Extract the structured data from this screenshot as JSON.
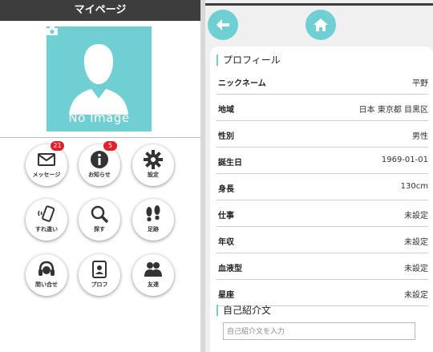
{
  "left": {
    "title": "マイページ",
    "avatar_text": "No Image",
    "menu": [
      {
        "label": "メッセージ",
        "icon": "mail-icon",
        "badge": "21"
      },
      {
        "label": "お知らせ",
        "icon": "info-icon",
        "badge": "5"
      },
      {
        "label": "設定",
        "icon": "gear-icon",
        "badge": ""
      },
      {
        "label": "すれ違い",
        "icon": "phone-vibrate-icon",
        "badge": ""
      },
      {
        "label": "探す",
        "icon": "search-icon",
        "badge": ""
      },
      {
        "label": "足跡",
        "icon": "footprints-icon",
        "badge": ""
      },
      {
        "label": "問い合せ",
        "icon": "headset-icon",
        "badge": ""
      },
      {
        "label": "プロフ",
        "icon": "profile-card-icon",
        "badge": ""
      },
      {
        "label": "友達",
        "icon": "friends-icon",
        "badge": ""
      }
    ]
  },
  "right": {
    "back_icon": "arrow-left-icon",
    "home_icon": "home-icon",
    "profile_heading": "プロフィール",
    "rows": [
      {
        "key": "ニックネーム",
        "value": "平野"
      },
      {
        "key": "地域",
        "value": "日本 東京都 目黒区"
      },
      {
        "key": "性別",
        "value": "男性"
      },
      {
        "key": "誕生日",
        "value": "1969-01-01"
      },
      {
        "key": "身長",
        "value": "130cm"
      },
      {
        "key": "仕事",
        "value": "未設定"
      },
      {
        "key": "年収",
        "value": "未設定"
      },
      {
        "key": "血液型",
        "value": "未設定"
      },
      {
        "key": "星座",
        "value": "未設定"
      }
    ],
    "intro_heading": "自己紹介文",
    "intro_placeholder": "自己紹介文を入力"
  },
  "colors": {
    "accent": "#6fcfd3",
    "header": "#3d3d3d",
    "badge": "#e0202a"
  }
}
